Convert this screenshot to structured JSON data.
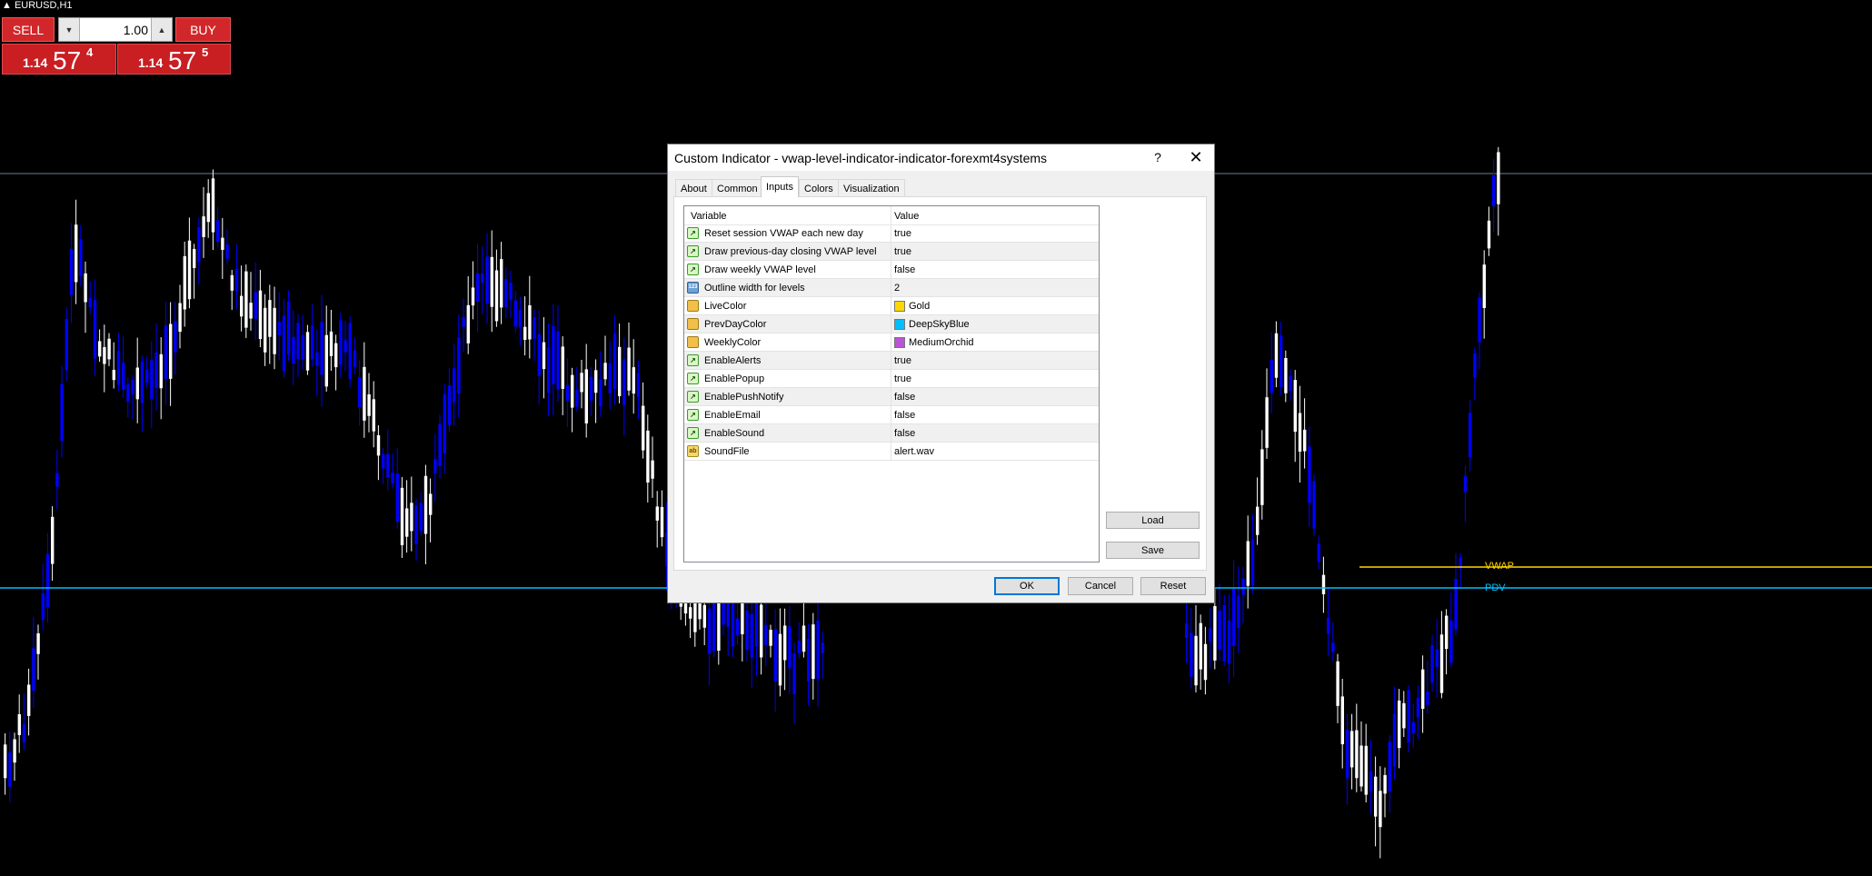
{
  "chart": {
    "symbol_label": "EURUSD,H1",
    "lines": {
      "vwap_label": "VWAP",
      "pdv_label": "PDV",
      "vwap_color": "#FFD700",
      "pdv_color": "#00BFFF"
    },
    "colors": {
      "background": "#000000",
      "bull_candle": "#ffffff",
      "bear_candle": "#0000ff",
      "grid_line": "#708090"
    }
  },
  "trade_panel": {
    "sell_label": "SELL",
    "buy_label": "BUY",
    "lot": "1.00",
    "bid": {
      "small": "1.14",
      "big": "57",
      "sup": "4"
    },
    "ask": {
      "small": "1.14",
      "big": "57",
      "sup": "5"
    },
    "accent": "#d1272b"
  },
  "dialog": {
    "title": "Custom Indicator - vwap-level-indicator-indicator-forexmt4systems",
    "help_label": "?",
    "close_label": "✕",
    "tabs": [
      {
        "label": "About"
      },
      {
        "label": "Common"
      },
      {
        "label": "Inputs"
      },
      {
        "label": "Colors"
      },
      {
        "label": "Visualization"
      }
    ],
    "active_tab": "Inputs",
    "grid": {
      "col_variable": "Variable",
      "col_value": "Value",
      "rows": [
        {
          "name": "Reset session VWAP each new day",
          "value": "true",
          "icon": "bool-icon"
        },
        {
          "name": "Draw previous-day closing VWAP level",
          "value": "true",
          "icon": "bool-icon"
        },
        {
          "name": "Draw weekly VWAP level",
          "value": "false",
          "icon": "bool-icon"
        },
        {
          "name": "Outline width for levels",
          "value": "2",
          "icon": "int-icon"
        },
        {
          "name": "LiveColor",
          "value": "Gold",
          "icon": "color-icon",
          "swatch": "#FFD700"
        },
        {
          "name": "PrevDayColor",
          "value": "DeepSkyBlue",
          "icon": "color-icon",
          "swatch": "#00BFFF"
        },
        {
          "name": "WeeklyColor",
          "value": "MediumOrchid",
          "icon": "color-icon",
          "swatch": "#BA55D3"
        },
        {
          "name": "EnableAlerts",
          "value": "true",
          "icon": "bool-icon"
        },
        {
          "name": "EnablePopup",
          "value": "true",
          "icon": "bool-icon"
        },
        {
          "name": "EnablePushNotify",
          "value": "false",
          "icon": "bool-icon"
        },
        {
          "name": "EnableEmail",
          "value": "false",
          "icon": "bool-icon"
        },
        {
          "name": "EnableSound",
          "value": "false",
          "icon": "bool-icon"
        },
        {
          "name": "SoundFile",
          "value": "alert.wav",
          "icon": "string-icon"
        }
      ]
    },
    "buttons": {
      "load": "Load",
      "save": "Save",
      "ok": "OK",
      "cancel": "Cancel",
      "reset": "Reset"
    }
  }
}
